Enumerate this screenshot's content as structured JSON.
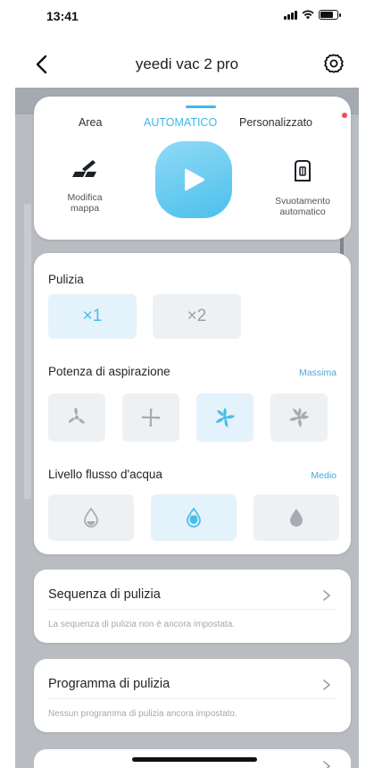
{
  "status_bar": {
    "time": "13:41"
  },
  "nav": {
    "title": "yeedi vac 2 pro"
  },
  "mode_tabs": [
    {
      "label": "Area",
      "selected": false
    },
    {
      "label": "AUTOMATICO",
      "selected": true
    },
    {
      "label": "Personalizzato",
      "selected": false
    }
  ],
  "actions": {
    "edit_map_label": "Modifica\nmappa",
    "auto_empty_label": "Svuotamento\nautomatico"
  },
  "cleaning": {
    "title": "Pulizia",
    "options": [
      {
        "label": "×1",
        "selected": true
      },
      {
        "label": "×2",
        "selected": false
      }
    ]
  },
  "suction": {
    "title": "Potenza di aspirazione",
    "value": "Massima",
    "selected_index": 2,
    "levels": [
      "fan-quiet-icon",
      "fan-standard-icon",
      "fan-max-icon",
      "fan-max-plus-icon"
    ]
  },
  "water": {
    "title": "Livello flusso d'acqua",
    "value": "Medio",
    "selected_index": 1,
    "levels": [
      "water-low-icon",
      "water-medium-icon",
      "water-high-icon"
    ]
  },
  "sequence": {
    "title": "Sequenza di pulizia",
    "subtitle": "La sequenza di pulizia non è ancora impostata."
  },
  "schedule": {
    "title": "Programma di pulizia",
    "subtitle": "Nessun programma di pulizia ancora impostato."
  },
  "colors": {
    "accent": "#3fb7e8",
    "map_background": "#b9bdc1",
    "badge_red": "#f04a5a"
  }
}
